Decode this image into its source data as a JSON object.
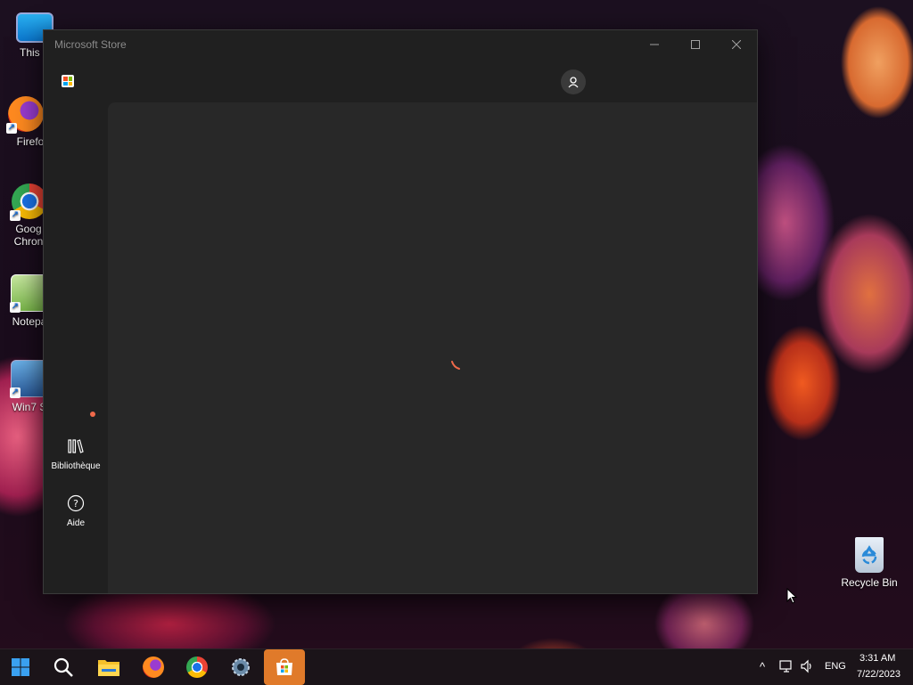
{
  "desktop": {
    "icons": [
      {
        "label": "This P"
      },
      {
        "label": "Firefo"
      },
      {
        "label": "Goog Chron"
      },
      {
        "label": "Notepa"
      },
      {
        "label": "Win7 S"
      }
    ],
    "recycle_bin_label": "Recycle Bin"
  },
  "window": {
    "title": "Microsoft Store"
  },
  "nav": {
    "library_label": "Bibliothèque",
    "help_label": "Aide"
  },
  "taskbar": {
    "clock_time": "3:31 AM",
    "clock_date": "7/22/2023",
    "language": "ENG"
  },
  "colors": {
    "accent": "#e07a2a",
    "badge": "#f0694a",
    "spinner": "#f0694a",
    "window_bg": "#202020",
    "content_bg": "#282828"
  }
}
